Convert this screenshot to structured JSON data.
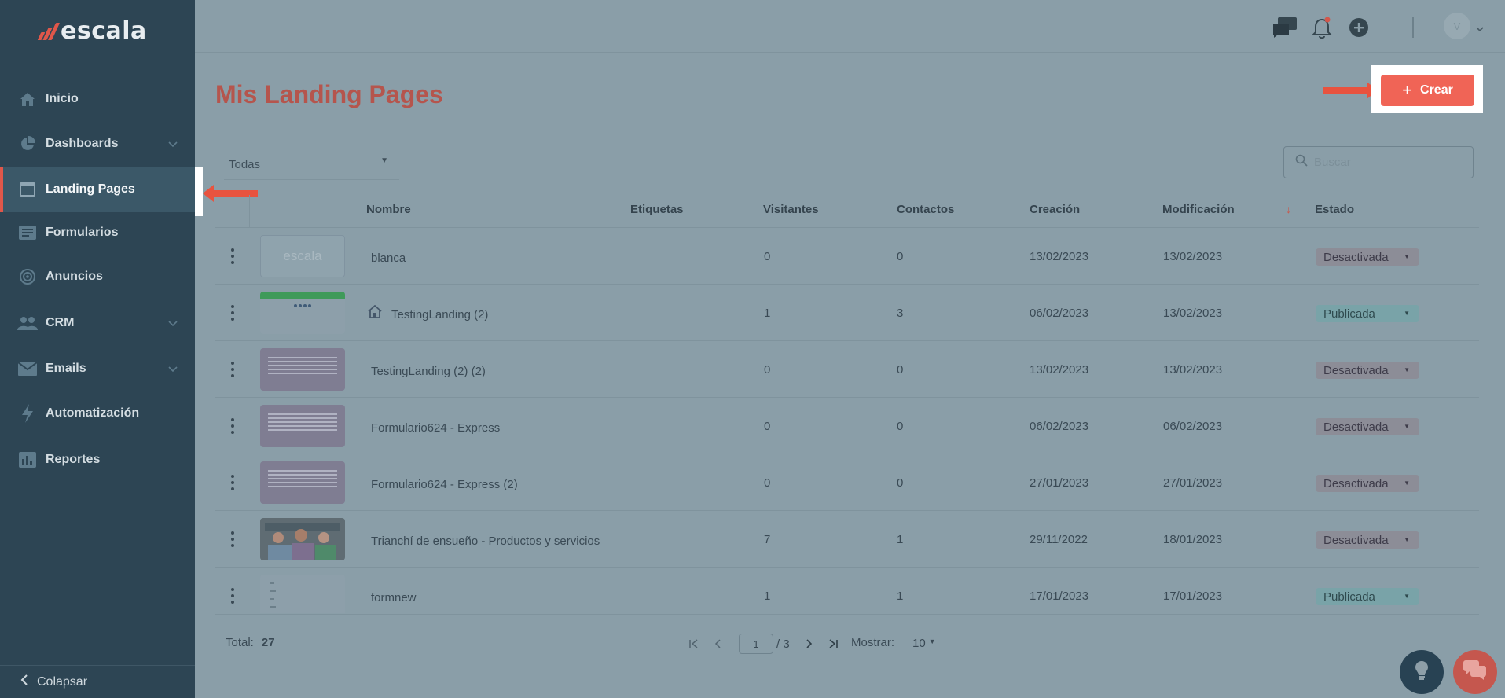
{
  "brand": {
    "name": "escala",
    "accent": "#e0574a"
  },
  "sidebar": {
    "items": [
      {
        "label": "Inicio",
        "icon": "home-icon"
      },
      {
        "label": "Dashboards",
        "icon": "pie-chart-icon"
      },
      {
        "label": "Landing Pages",
        "icon": "browser-window-icon"
      },
      {
        "label": "Formularios",
        "icon": "form-icon"
      },
      {
        "label": "Anuncios",
        "icon": "target-icon"
      },
      {
        "label": "CRM",
        "icon": "users-icon"
      },
      {
        "label": "Emails",
        "icon": "envelope-icon"
      },
      {
        "label": "Automatización",
        "icon": "lightning-icon"
      },
      {
        "label": "Reportes",
        "icon": "report-icon"
      }
    ],
    "collapse_label": "Colapsar"
  },
  "header": {
    "avatar_initial": "V"
  },
  "main": {
    "title": "Mis Landing Pages",
    "create_label": "Crear",
    "filter_value": "Todas",
    "search_placeholder": "Buscar"
  },
  "table": {
    "columns": [
      "Nombre",
      "Etiquetas",
      "Visitantes",
      "Contactos",
      "Creación",
      "Modificación",
      "Estado"
    ],
    "rows": [
      {
        "name": "blanca",
        "visitors": "0",
        "contacts": "0",
        "created": "13/02/2023",
        "modified": "13/02/2023",
        "status": "Desactivada",
        "thumb_text": "escala"
      },
      {
        "name": "TestingLanding (2)",
        "visitors": "1",
        "contacts": "3",
        "created": "06/02/2023",
        "modified": "13/02/2023",
        "status": "Publicada"
      },
      {
        "name": "TestingLanding (2) (2)",
        "visitors": "0",
        "contacts": "0",
        "created": "13/02/2023",
        "modified": "13/02/2023",
        "status": "Desactivada"
      },
      {
        "name": "Formulario624 - Express",
        "visitors": "0",
        "contacts": "0",
        "created": "06/02/2023",
        "modified": "06/02/2023",
        "status": "Desactivada"
      },
      {
        "name": "Formulario624 - Express (2)",
        "visitors": "0",
        "contacts": "0",
        "created": "27/01/2023",
        "modified": "27/01/2023",
        "status": "Desactivada"
      },
      {
        "name": "Trianchí de ensueño - Productos y servicios",
        "visitors": "7",
        "contacts": "1",
        "created": "29/11/2022",
        "modified": "18/01/2023",
        "status": "Desactivada"
      },
      {
        "name": "formnew",
        "visitors": "1",
        "contacts": "1",
        "created": "17/01/2023",
        "modified": "17/01/2023",
        "status": "Publicada"
      }
    ]
  },
  "pagination": {
    "total_label": "Total:",
    "total": "27",
    "page": "1",
    "of_pages": "/ 3",
    "show_label": "Mostrar:",
    "show_value": "10"
  }
}
